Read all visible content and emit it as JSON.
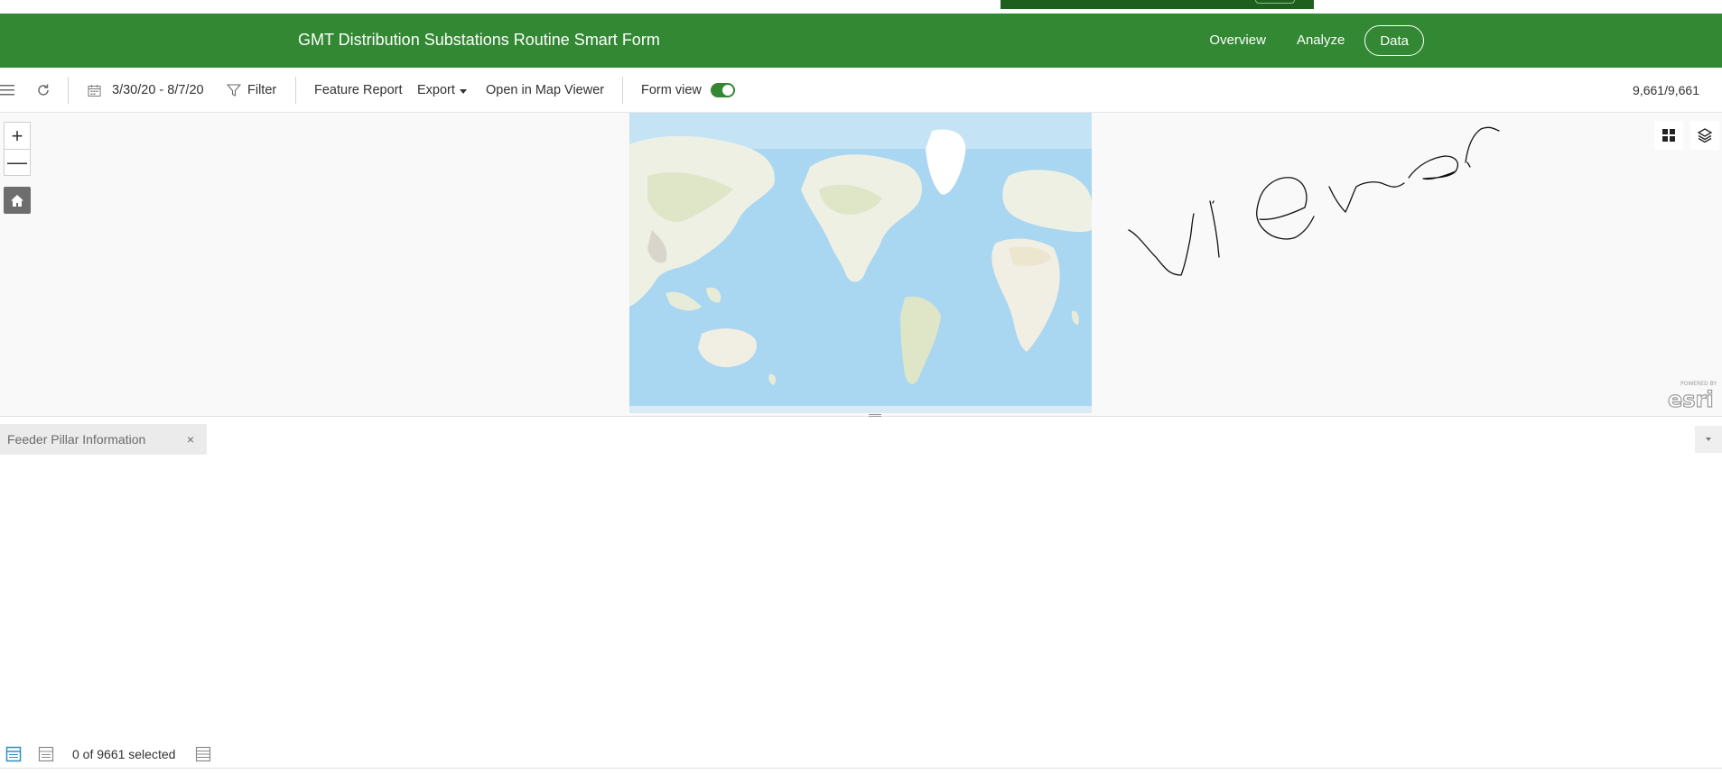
{
  "header": {
    "title": "GMT Distribution Substations Routine Smart Form",
    "nav": [
      {
        "label": "Overview",
        "active": false
      },
      {
        "label": "Analyze",
        "active": false
      },
      {
        "label": "Data",
        "active": true
      }
    ],
    "brand_color": "#338833"
  },
  "toolbar": {
    "menu_icon": "hamburger-menu-icon",
    "refresh_icon": "refresh-icon",
    "date_range": "3/30/20 - 8/7/20",
    "filter_label": "Filter",
    "feature_report_label": "Feature Report",
    "export_label": "Export",
    "open_map_viewer_label": "Open in Map Viewer",
    "form_view_label": "Form view",
    "form_view_enabled": true,
    "record_count": "9,661/9,661"
  },
  "map": {
    "zoom_in": "+",
    "zoom_out": "—",
    "home_icon": "home-icon",
    "basemap_icon": "basemap-gallery-icon",
    "layers_icon": "layers-icon",
    "handwritten_annotation": "viewer",
    "attribution": "POWERED BY esri"
  },
  "table": {
    "tab_label": "Feeder Pillar Information",
    "close_symbol": "×",
    "selection_status": "0 of 9661 selected"
  }
}
